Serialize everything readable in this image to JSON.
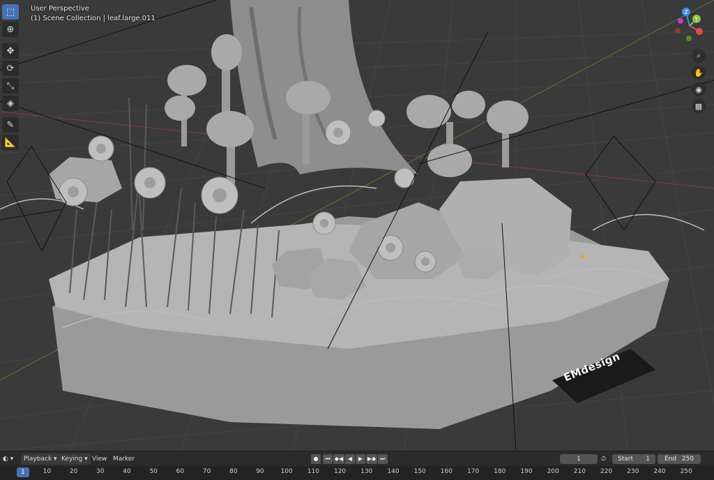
{
  "viewport": {
    "perspective_label": "User Perspective",
    "collection_label": "(1) Scene Collection | leaf.large.011",
    "logo_text": "EMdesign",
    "gizmo": {
      "z": "Z",
      "y": "Y",
      "x_color": "#e04a4a",
      "y_color": "#8bc34a",
      "z_color": "#3d8ee8"
    }
  },
  "toolbar": {
    "tools": [
      {
        "name": "select-box-tool",
        "icon": "⬚",
        "active": true
      },
      {
        "name": "cursor-tool",
        "icon": "⊕",
        "active": false
      },
      {
        "name": "move-tool",
        "icon": "✥",
        "active": false
      },
      {
        "name": "rotate-tool",
        "icon": "⟳",
        "active": false
      },
      {
        "name": "scale-tool",
        "icon": "⤡",
        "active": false
      },
      {
        "name": "transform-tool",
        "icon": "◈",
        "active": false
      },
      {
        "name": "annotate-tool",
        "icon": "✎",
        "active": false
      },
      {
        "name": "measure-tool",
        "icon": "📐",
        "active": false
      }
    ]
  },
  "timeline": {
    "editor_icon": "◐",
    "menus": [
      "Playback",
      "Keying",
      "View",
      "Marker"
    ],
    "current_frame": "1",
    "start_label": "Start",
    "start_value": "1",
    "end_label": "End",
    "end_value": "250",
    "ruler_ticks": [
      1,
      10,
      20,
      30,
      40,
      50,
      60,
      70,
      80,
      90,
      100,
      110,
      120,
      130,
      140,
      150,
      160,
      170,
      180,
      190,
      200,
      210,
      220,
      230,
      240,
      250
    ],
    "playback_icons": [
      "●",
      "⏮",
      "◆◀",
      "◀",
      "▶",
      "▶◆",
      "⏭"
    ]
  },
  "colors": {
    "accent": "#4772b3",
    "viewport_bg": "#3a3a3a",
    "panel_bg": "#2b2b2b"
  }
}
